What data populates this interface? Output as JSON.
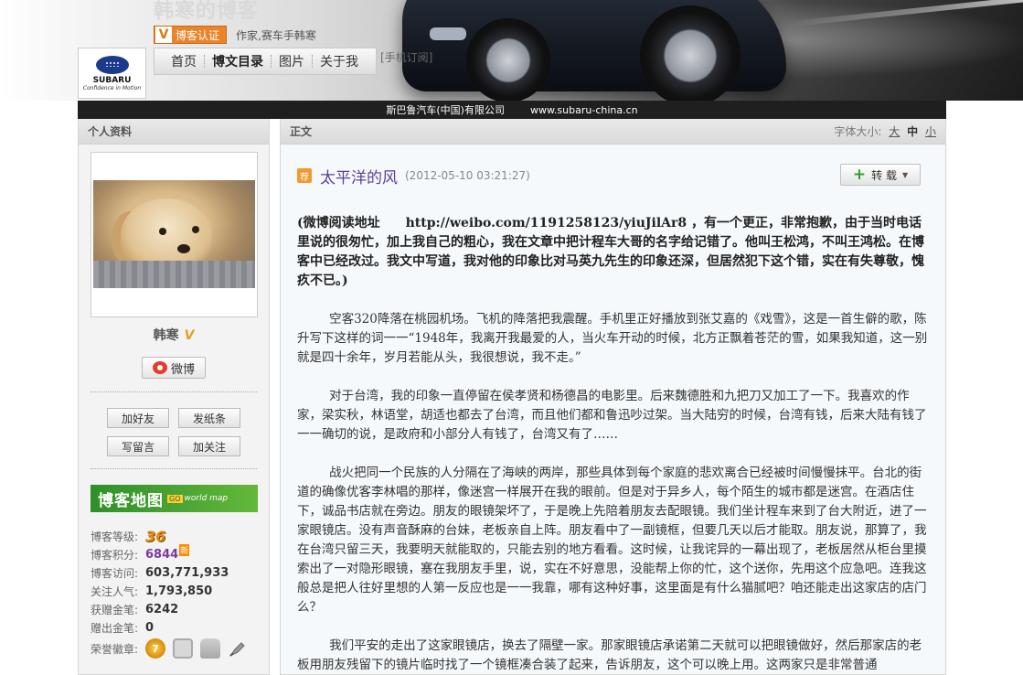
{
  "header": {
    "blog_title": "韩寒的博客",
    "verify_label": "博客认证",
    "description": "作家,赛车手韩寒",
    "logo_brand": "SUBARU",
    "logo_tagline": "Confidence in Motion",
    "nav": [
      "首页",
      "博文目录",
      "图片",
      "关于我"
    ],
    "mobile_subscribe": "[手机订阅]",
    "sponsor_company": "斯巴鲁汽车(中国)有限公司",
    "sponsor_url": "www.subaru-china.cn"
  },
  "sidebar": {
    "title": "个人资料",
    "user_name": "韩寒",
    "weibo_label": "微博",
    "buttons": [
      "加好友",
      "发纸条",
      "写留言",
      "加关注"
    ],
    "map_banner": {
      "text": "博客地图",
      "badge": "GO",
      "sub": "world map"
    },
    "stats": [
      {
        "label": "博客等级:",
        "value": "36"
      },
      {
        "label": "博客积分:",
        "value": "6844",
        "badge": "新"
      },
      {
        "label": "博客访问:",
        "value": "603,771,933"
      },
      {
        "label": "关注人气:",
        "value": "1,793,850"
      },
      {
        "label": "获赠金笔:",
        "value": "6242"
      },
      {
        "label": "赠出金笔:",
        "value": "0"
      },
      {
        "label": "荣誉徽章:",
        "value": ""
      }
    ],
    "medal_level": "7"
  },
  "main": {
    "section_label": "正文",
    "font_size_label": "字体大小:",
    "font_sizes": [
      "大",
      "中",
      "小"
    ],
    "rec_badge": "荐",
    "title": "太平洋的风",
    "time": "(2012-05-10 03:21:27)",
    "repost_label": "转 载",
    "paragraphs": [
      "(微博阅读地址　　http://weibo.com/1191258123/yiuJilAr8 ，有一个更正，非常抱歉，由于当时电话里说的很匆忙，加上我自己的粗心，我在文章中把计程车大哥的名字给记错了。他叫王松鸿，不叫王鸿松。在博客中已经改过。我文中写道，我对他的印象比对马英九先生的印象还深，但居然犯下这个错，实在有失尊敬，愧疚不已。)",
      "空客320降落在桃园机场。飞机的降落把我震醒。手机里正好播放到张艾嘉的《戏雪》，这是一首生僻的歌，陈升写下这样的词一一“1948年，我离开我最爱的人，当火车开动的时候，北方正飘着苍茫的雪，如果我知道，这一别就是四十余年，岁月若能从头，我很想说，我不走。”",
      "对于台湾，我的印象一直停留在侯孝贤和杨德昌的电影里。后来魏德胜和九把刀又加工了一下。我喜欢的作家，梁实秋，林语堂，胡适也都去了台湾，而且他们都和鲁迅吵过架。当大陆穷的时候，台湾有钱，后来大陆有钱了一一确切的说，是政府和小部分人有钱了，台湾又有了……",
      "战火把同一个民族的人分隔在了海峡的两岸，那些具体到每个家庭的悲欢离合已经被时间慢慢抹平。台北的街道的确像优客李林唱的那样，像迷宫一样展开在我的眼前。但是对于异乡人，每个陌生的城市都是迷宫。在酒店住下，诚品书店就在旁边。朋友的眼镜架坏了，于是晚上先陪着朋友去配眼镜。我们坐计程车来到了台大附近，进了一家眼镜店。没有声音酥麻的台妹，老板亲自上阵。朋友看中了一副镜框，但要几天以后才能取。朋友说，那算了，我在台湾只留三天，我要明天就能取的，只能去别的地方看看。这时候，让我诧异的一幕出现了，老板居然从柜台里摸索出了一对隐形眼镜，塞在我朋友手里，说，实在不好意思，没能帮上你的忙，这个送你，先用这个应急吧。连我这般总是把人往好里想的人第一反应也是一一我靠，哪有这种好事，这里面是有什么猫腻吧？咱还能走出这家店的店门么？",
      "我们平安的走出了这家眼镜店，换去了隔壁一家。那家眼镜店承诺第二天就可以把眼镜做好，然后那家店的老板用朋友残留下的镜片临时找了一个镜框凑合装了起来，告诉朋友，这个可以晚上用。这两家只是非常普通"
    ]
  }
}
